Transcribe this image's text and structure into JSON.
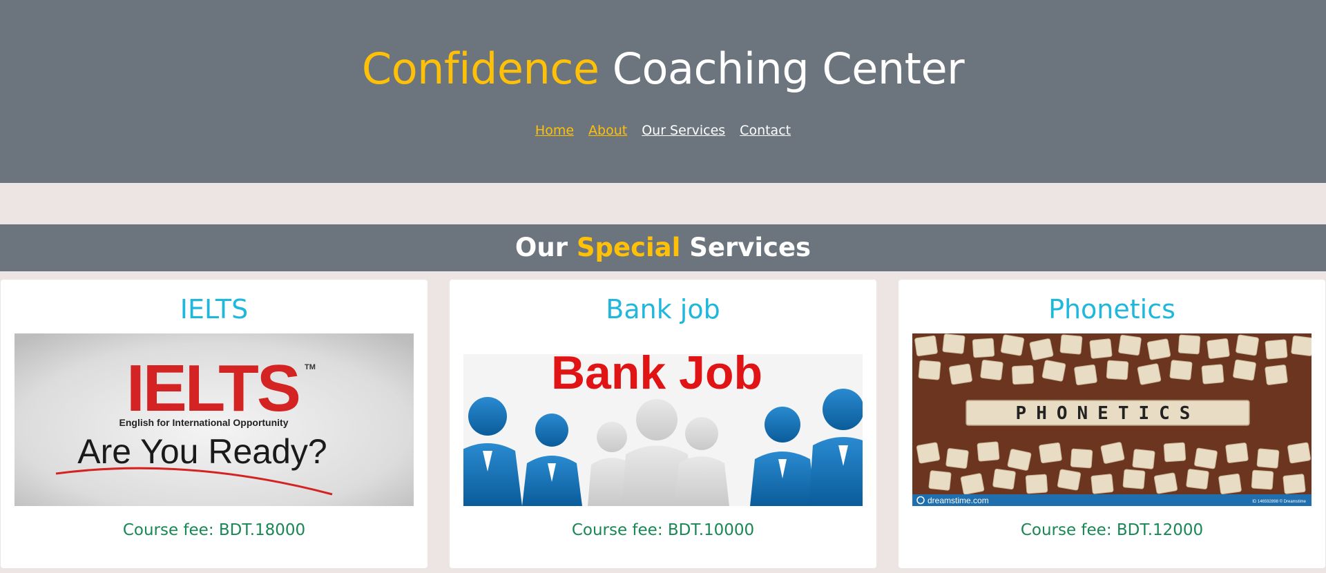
{
  "header": {
    "title_accent": "Confidence",
    "title_rest": " Coaching Center",
    "nav": [
      {
        "label": "Home"
      },
      {
        "label": "About"
      },
      {
        "label": "Our Services"
      },
      {
        "label": "Contact"
      }
    ]
  },
  "services": {
    "heading_pre": "Our ",
    "heading_accent": "Special",
    "heading_post": " Services"
  },
  "cards": [
    {
      "title": "IELTS",
      "fee": "Course fee: BDT.18000",
      "image": {
        "brand": "IELTS",
        "tm": "TM",
        "tagline": "English for International Opportunity",
        "slogan": "Are You Ready?"
      }
    },
    {
      "title": "Bank job",
      "fee": "Course fee: BDT.10000",
      "image": {
        "headline": "Bank Job"
      }
    },
    {
      "title": "Phonetics",
      "fee": "Course fee: BDT.12000",
      "image": {
        "word": "PHONETICS",
        "watermark": "dreamstime.com",
        "credit": "ID 146592898 © Dreamstime"
      }
    }
  ],
  "colors": {
    "header_bg": "#6c757d",
    "page_bg": "#ede5e4",
    "accent": "#ffc107",
    "card_title": "#1fb7db",
    "fee": "#198754"
  }
}
